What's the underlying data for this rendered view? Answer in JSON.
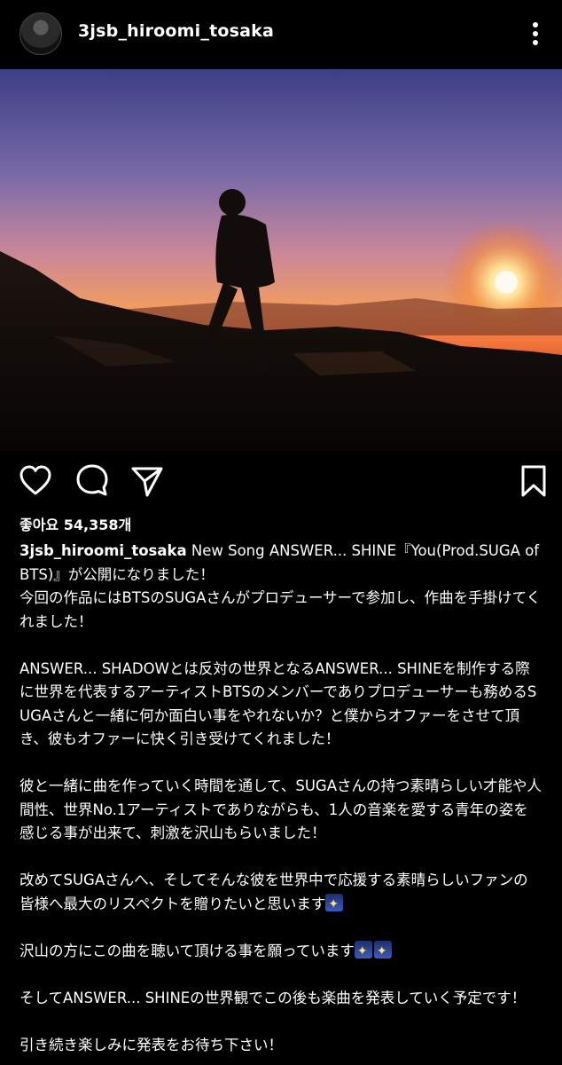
{
  "header": {
    "username": "3jsb_hiroomi_tosaka",
    "avatar_icon": "profile-avatar",
    "more_icon": "vertical-dots-icon"
  },
  "post": {
    "image_icon": "sunset-mountain-silhouette-photo",
    "actions": {
      "like_icon": "heart-icon",
      "comment_icon": "comment-bubble-icon",
      "share_icon": "paper-plane-icon",
      "save_icon": "bookmark-icon"
    },
    "likes_text": "좋아요 54,358개",
    "caption": {
      "username": "3jsb_hiroomi_tosaka",
      "p1": " New Song ANSWER... SHINE『You(Prod.SUGA of BTS)』が公開になりました！\n今回の作品にはBTSのSUGAさんがプロデューサーで参加し、作曲を手掛けてくれました！",
      "p2": "ANSWER... SHADOWとは反対の世界となるANSWER... SHINEを制作する際に世界を代表するアーティストBTSのメンバーでありプロデューサーも務めるSUGAさんと一緒に何か面白い事をやれないか？と僕からオファーをさせて頂き、彼もオファーに快く引き受けてくれました！",
      "p3": "彼と一緒に曲を作っていく時間を通して、SUGAさんの持つ素晴らしい才能や人間性、世界No.1アーティストでありながらも、1人の音楽を愛する青年の姿を感じる事が出来て、刺激を沢山もらいました！",
      "p4": "改めてSUGAさんへ、そしてそんな彼を世界中で応援する素晴らしいファンの皆様へ最大のリスペクトを贈りたいと思います",
      "p5": "沢山の方にこの曲を聴いて頂ける事を願っています",
      "p6": "そしてANSWER... SHINEの世界観でこの後も楽曲を発表していく予定です！",
      "p7": "引き続き楽しみに発表をお待ち下さい！"
    }
  },
  "colors": {
    "background": "#000000",
    "text": "#ffffff",
    "sky_top": "#3b3f86",
    "sky_horizon": "#f28a3a",
    "sun": "#fff3c0"
  }
}
